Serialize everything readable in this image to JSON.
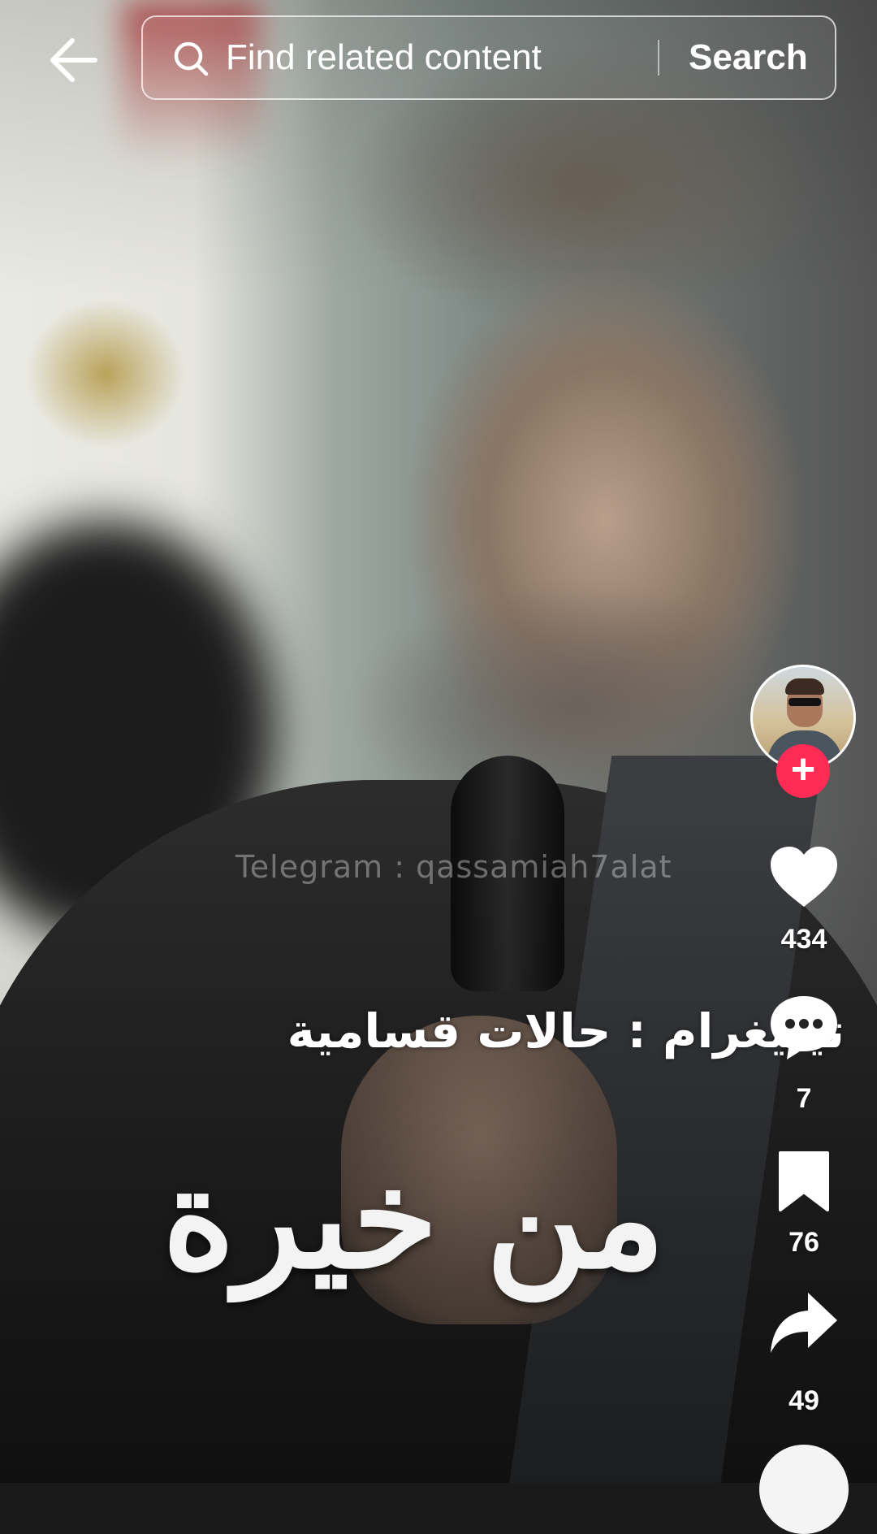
{
  "search": {
    "placeholder": "Find related content",
    "button_label": "Search"
  },
  "video": {
    "watermark": "Telegram : qassamiah7alat",
    "caption_line1": "تيليغرام : حالات قسامية",
    "caption_line2": "من خيرة"
  },
  "actions": {
    "likes": "434",
    "comments": "7",
    "saves": "76",
    "shares": "49"
  },
  "colors": {
    "follow_accent": "#fe2c55",
    "icon": "#ffffff"
  },
  "icons": [
    "back-arrow-icon",
    "search-icon",
    "plus-icon",
    "heart-icon",
    "comment-icon",
    "bookmark-icon",
    "share-icon"
  ]
}
